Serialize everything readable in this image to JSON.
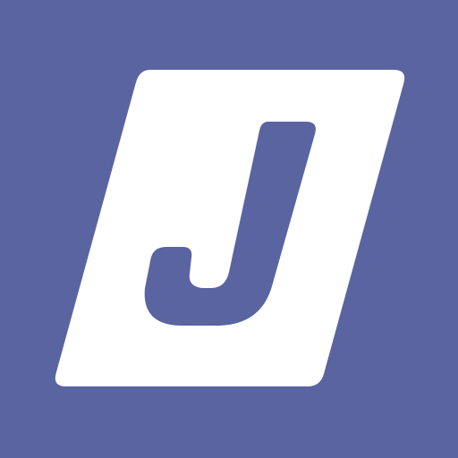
{
  "icon": {
    "name": "J logo app icon",
    "letter": "J",
    "colors": {
      "background": "#5a64a1",
      "plate": "#ffffff",
      "letter": "#5a64a1"
    }
  }
}
